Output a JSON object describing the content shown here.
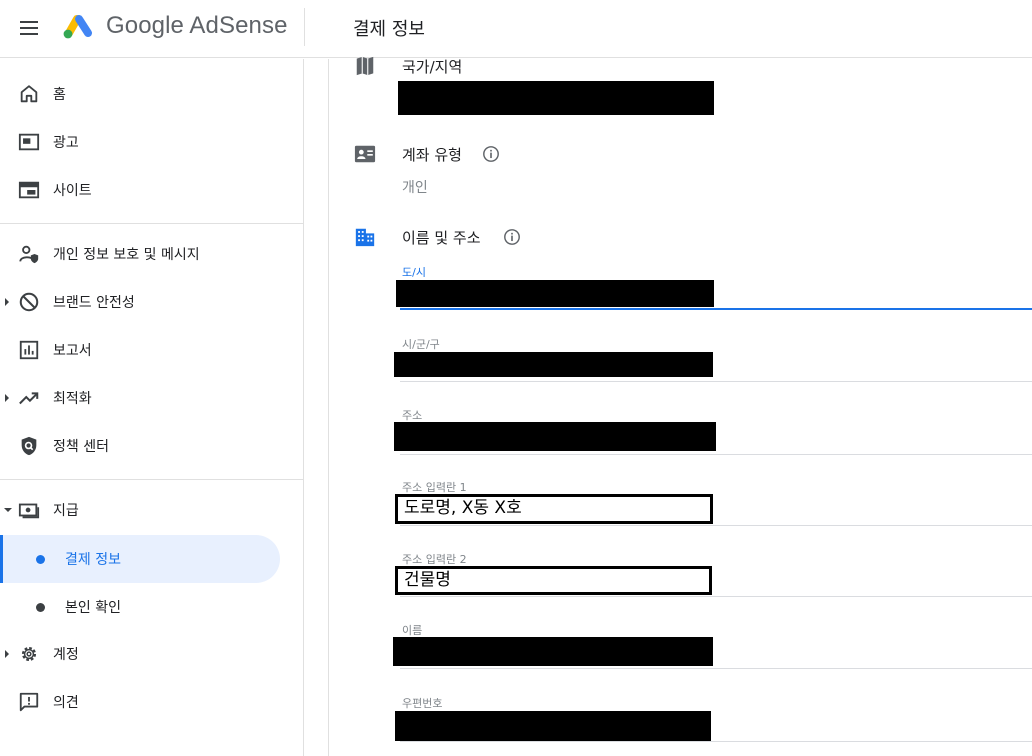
{
  "app": {
    "brand": "Google AdSense",
    "page_title": "결제 정보"
  },
  "colors": {
    "accent": "#1a73e8",
    "active_bg": "#e8f0fe",
    "text": "#202124",
    "muted": "#80868b"
  },
  "sidebar": {
    "items": [
      {
        "label": "홈",
        "icon": "home-icon"
      },
      {
        "label": "광고",
        "icon": "ads-icon"
      },
      {
        "label": "사이트",
        "icon": "sites-icon"
      },
      {
        "label": "개인 정보 보호 및 메시지",
        "icon": "privacy-icon"
      },
      {
        "label": "브랜드 안전성",
        "icon": "block-icon"
      },
      {
        "label": "보고서",
        "icon": "reports-icon"
      },
      {
        "label": "최적화",
        "icon": "trending-icon"
      },
      {
        "label": "정책 센터",
        "icon": "policy-shield-icon"
      },
      {
        "label": "지급",
        "icon": "payments-icon"
      },
      {
        "label": "계정",
        "icon": "gear-icon"
      },
      {
        "label": "의견",
        "icon": "feedback-icon"
      }
    ],
    "payments_sub": [
      {
        "label": "결제 정보",
        "active": true
      },
      {
        "label": "본인 확인",
        "active": false
      }
    ]
  },
  "main": {
    "country": {
      "title": "국가/지역"
    },
    "account_type": {
      "title": "계좌 유형",
      "value": "개인"
    },
    "name_address": {
      "title": "이름 및 주소",
      "fields": [
        {
          "label": "도/시"
        },
        {
          "label": "시/군/구"
        },
        {
          "label": "주소"
        },
        {
          "label": "주소 입력란 1",
          "value": "도로명, X동 X호"
        },
        {
          "label": "주소 입력란 2",
          "value": "건물명"
        },
        {
          "label": "이름"
        },
        {
          "label": "우편번호"
        }
      ]
    }
  }
}
